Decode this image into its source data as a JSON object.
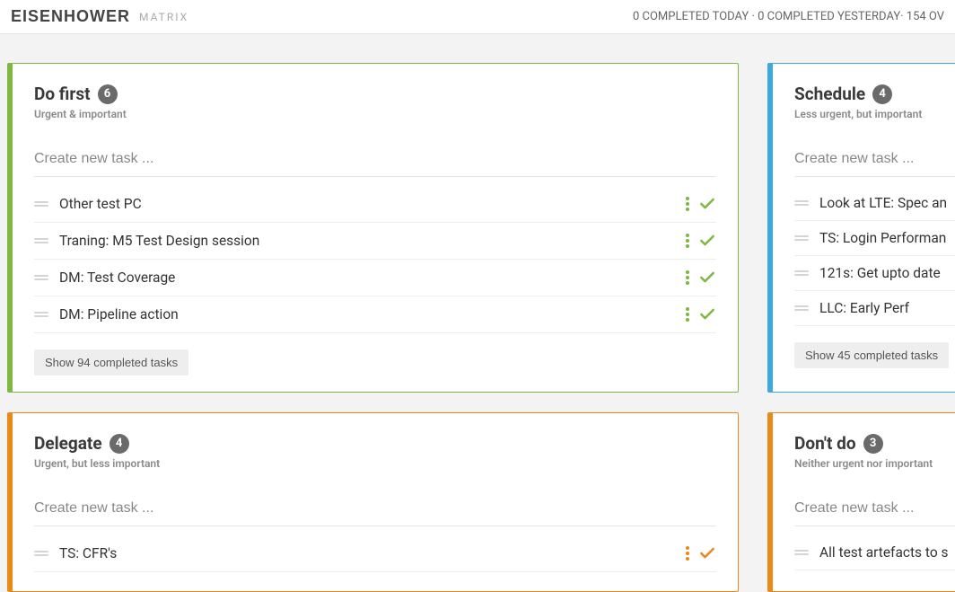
{
  "header": {
    "brand": "EISENHOWER",
    "brand_sub": "MATRIX",
    "stats": "0 COMPLETED TODAY · 0 COMPLETED YESTERDAY· 154 OV"
  },
  "new_task_placeholder": "Create new task ...",
  "quadrants": {
    "do_first": {
      "title": "Do first",
      "count": "6",
      "subtitle": "Urgent & important",
      "tasks": [
        "Other test PC",
        "Traning: M5 Test Design session",
        "DM: Test Coverage",
        "DM: Pipeline action"
      ],
      "show_completed": "Show 94 completed tasks"
    },
    "schedule": {
      "title": "Schedule",
      "count": "4",
      "subtitle": "Less urgent, but important",
      "tasks": [
        "Look at LTE: Spec an",
        "TS: Login Performan",
        "121s: Get upto date",
        "LLC: Early Perf"
      ],
      "show_completed": "Show 45 completed tasks"
    },
    "delegate": {
      "title": "Delegate",
      "count": "4",
      "subtitle": "Urgent, but less important",
      "tasks": [
        "TS: CFR's"
      ]
    },
    "dont_do": {
      "title": "Don't do",
      "count": "3",
      "subtitle": "Neither urgent nor important",
      "tasks": [
        "All test artefacts to s"
      ]
    }
  }
}
